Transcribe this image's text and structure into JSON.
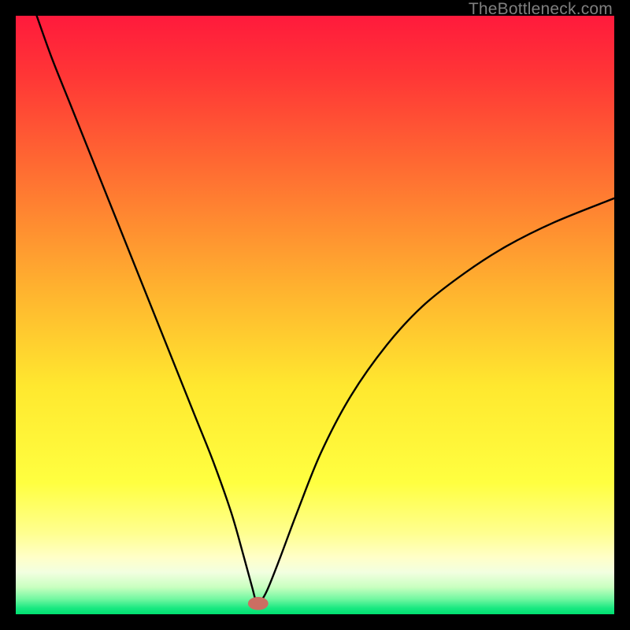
{
  "watermark": "TheBottleneck.com",
  "chart_data": {
    "type": "line",
    "title": "",
    "xlabel": "",
    "ylabel": "",
    "xlim": [
      0,
      100
    ],
    "ylim": [
      0,
      100
    ],
    "background_gradient": {
      "stops": [
        {
          "pos": 0.0,
          "color": "#ff1a3c"
        },
        {
          "pos": 0.1,
          "color": "#ff3636"
        },
        {
          "pos": 0.25,
          "color": "#ff6a32"
        },
        {
          "pos": 0.45,
          "color": "#ffb02f"
        },
        {
          "pos": 0.62,
          "color": "#ffe82f"
        },
        {
          "pos": 0.78,
          "color": "#ffff40"
        },
        {
          "pos": 0.865,
          "color": "#ffff90"
        },
        {
          "pos": 0.905,
          "color": "#ffffc8"
        },
        {
          "pos": 0.93,
          "color": "#f2ffe0"
        },
        {
          "pos": 0.955,
          "color": "#c8ffc0"
        },
        {
          "pos": 0.975,
          "color": "#70f7a0"
        },
        {
          "pos": 0.99,
          "color": "#18e880"
        },
        {
          "pos": 1.0,
          "color": "#00e070"
        }
      ]
    },
    "series": [
      {
        "name": "bottleneck-curve",
        "color": "#000000",
        "x": [
          3.5,
          6,
          9,
          12,
          15,
          18,
          21,
          24,
          27,
          30,
          33,
          36,
          38,
          39.5,
          40.2,
          40.8,
          42,
          44,
          47,
          51,
          56,
          62,
          68,
          75,
          82,
          90,
          100
        ],
        "y": [
          100,
          93,
          85.5,
          78,
          70.5,
          63,
          55.5,
          48,
          40.5,
          33,
          25.5,
          17,
          10,
          4.5,
          2.0,
          2.0,
          4,
          9,
          17,
          27,
          36.5,
          45,
          51.5,
          57,
          61.5,
          65.5,
          69.5
        ]
      }
    ],
    "marker": {
      "name": "optimal-point",
      "x": 40.5,
      "y": 1.8,
      "color": "#cc6e62",
      "rx": 1.7,
      "ry": 1.1
    }
  }
}
